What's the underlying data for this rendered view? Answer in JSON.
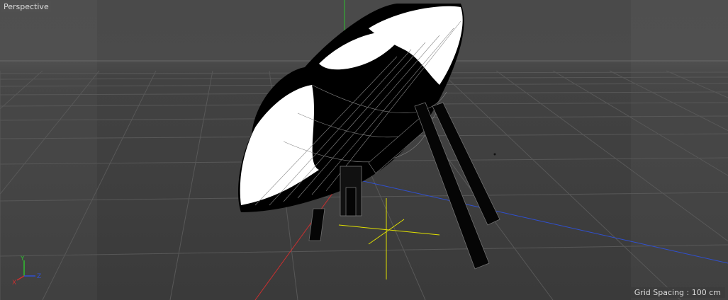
{
  "viewport": {
    "camera_label": "Perspective",
    "grid_spacing_label": "Grid Spacing : 100 cm"
  },
  "axis_gizmo": {
    "x_label": "X",
    "y_label": "Y",
    "z_label": "Z"
  },
  "colors": {
    "x_axis": "#c83030",
    "y_axis": "#30c030",
    "z_axis": "#3050d0",
    "background": "#3d3d3d",
    "grid": "#5a5a5a",
    "model_fill": "#000000",
    "model_highlight": "#ffffff"
  },
  "icons": [
    "axis-gizmo-icon"
  ]
}
